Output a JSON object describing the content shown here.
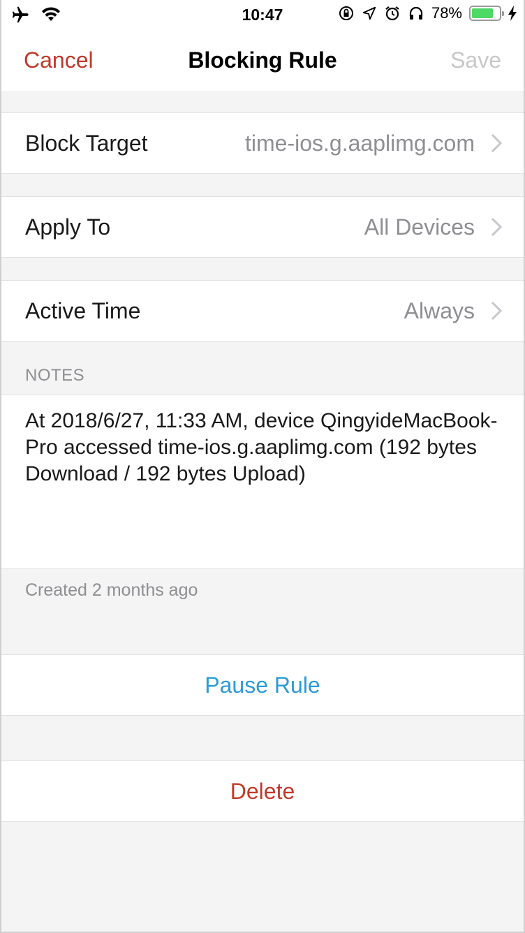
{
  "status_bar": {
    "time": "10:47",
    "battery_percent": "78%",
    "battery_level": 0.78,
    "icons": [
      "airplane-icon",
      "wifi-icon",
      "rotation-lock-icon",
      "location-icon",
      "alarm-icon",
      "headphones-icon",
      "battery-icon",
      "charging-icon"
    ]
  },
  "nav": {
    "cancel_label": "Cancel",
    "title": "Blocking Rule",
    "save_label": "Save"
  },
  "rows": [
    {
      "label": "Block Target",
      "value": "time-ios.g.aaplimg.com"
    },
    {
      "label": "Apply To",
      "value": "All Devices"
    },
    {
      "label": "Active Time",
      "value": "Always"
    }
  ],
  "notes": {
    "header": "NOTES",
    "text": "At 2018/6/27, 11:33 AM, device QingyideMacBook-Pro accessed time-ios.g.aaplimg.com (192 bytes Download / 192 bytes Upload)",
    "footer": "Created 2 months ago"
  },
  "actions": {
    "pause_label": "Pause Rule",
    "delete_label": "Delete"
  },
  "colors": {
    "accent_red": "#c0392b",
    "accent_blue": "#2d9bd8",
    "battery_green": "#4cd964"
  }
}
